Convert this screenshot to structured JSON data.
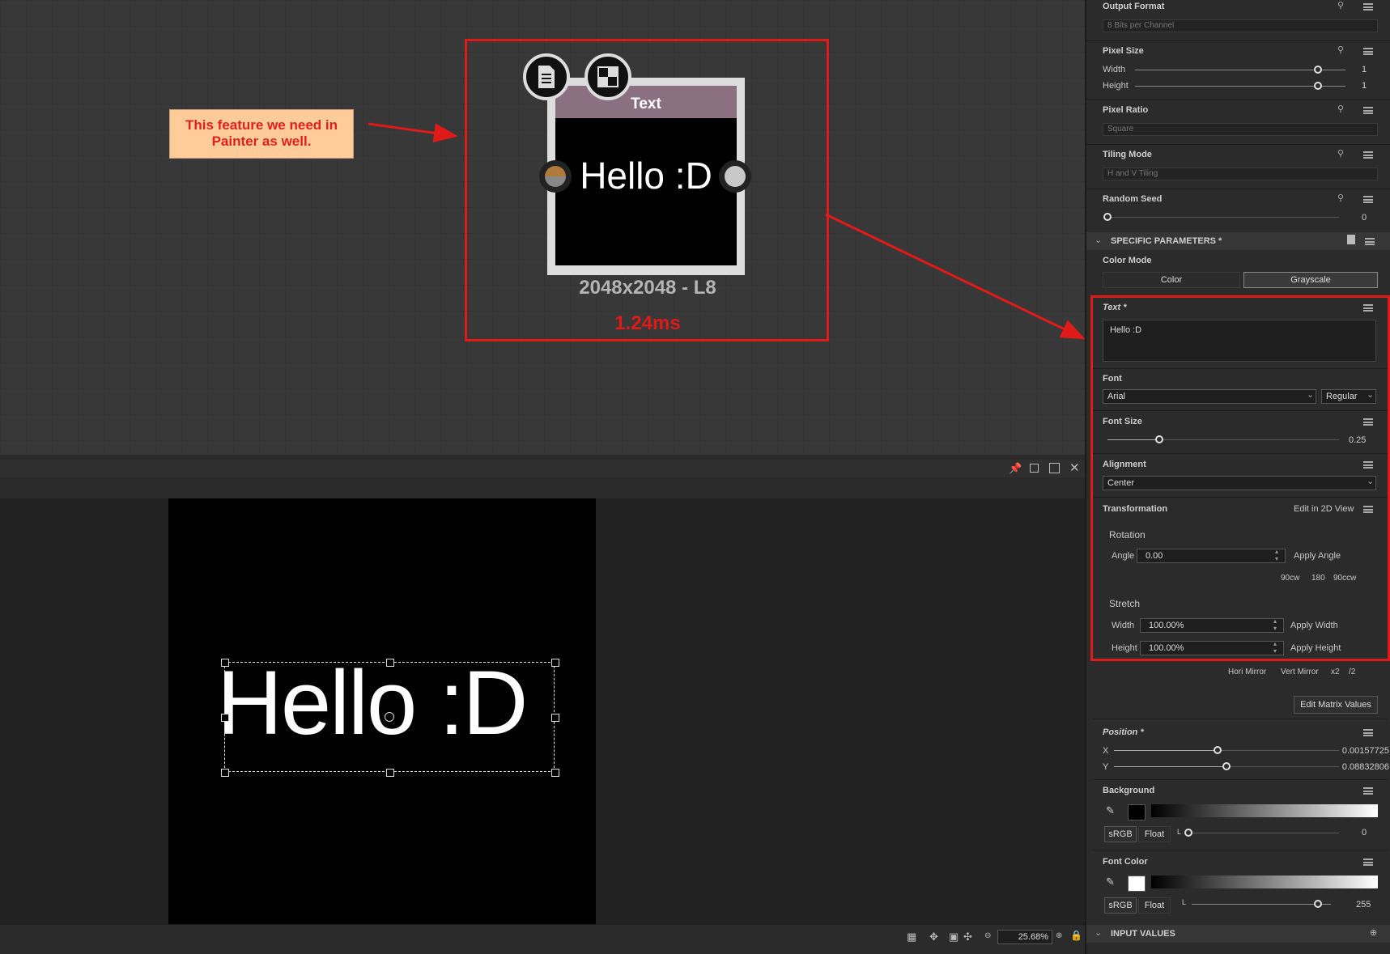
{
  "graph": {
    "note": {
      "line1": "This feature we need in",
      "line2": "Painter as well."
    },
    "node": {
      "title": "Text",
      "preview_text": "Hello :D",
      "resolution": "2048x2048 - L8",
      "timing": "1.24ms"
    }
  },
  "view2d": {
    "canvas_text": "Hello :D",
    "zoom": "25.68%"
  },
  "panel": {
    "output_format": {
      "title": "Output Format",
      "value": "8 Bits per Channel"
    },
    "pixel_size": {
      "title": "Pixel Size",
      "width_label": "Width",
      "width_value": "1",
      "height_label": "Height",
      "height_value": "1"
    },
    "pixel_ratio": {
      "title": "Pixel Ratio",
      "value": "Square"
    },
    "tiling_mode": {
      "title": "Tiling Mode",
      "value": "H and V Tiling"
    },
    "random_seed": {
      "title": "Random Seed",
      "value": "0"
    },
    "specific_header": "SPECIFIC PARAMETERS *",
    "color_mode": {
      "title": "Color Mode",
      "opt1": "Color",
      "opt2": "Grayscale"
    },
    "text": {
      "title": "Text *",
      "value": "Hello :D"
    },
    "font": {
      "title": "Font",
      "family": "Arial",
      "style": "Regular"
    },
    "font_size": {
      "title": "Font Size",
      "value": "0.25",
      "level": 0.25
    },
    "alignment": {
      "title": "Alignment",
      "value": "Center"
    },
    "transformation": {
      "title": "Transformation",
      "edit_link": "Edit in 2D View",
      "rotation": "Rotation",
      "angle_label": "Angle",
      "angle_value": "0.00",
      "apply_angle": "Apply Angle",
      "r90cw": "90cw",
      "r180": "180",
      "r90ccw": "90ccw",
      "stretch": "Stretch",
      "width_label": "Width",
      "width_value": "100.00%",
      "apply_width": "Apply Width",
      "height_label": "Height",
      "height_value": "100.00%",
      "apply_height": "Apply Height",
      "hori_mirror": "Hori Mirror",
      "vert_mirror": "Vert Mirror",
      "x2": "x2",
      "div2": "/2",
      "edit_matrix": "Edit Matrix Values"
    },
    "position": {
      "title": "Position *",
      "x_label": "X",
      "x_value": "0.00157725",
      "y_label": "Y",
      "y_value": "0.08832806"
    },
    "background": {
      "title": "Background",
      "srgb": "sRGB",
      "float": "Float",
      "l_label": "L",
      "value": "0"
    },
    "font_color": {
      "title": "Font Color",
      "srgb": "sRGB",
      "float": "Float",
      "l_label": "L",
      "value": "255"
    },
    "input_values": "INPUT VALUES"
  },
  "colors": {
    "annotation_red": "#e01919",
    "note_bg": "#ffcc99",
    "node_header": "#8a7080"
  }
}
